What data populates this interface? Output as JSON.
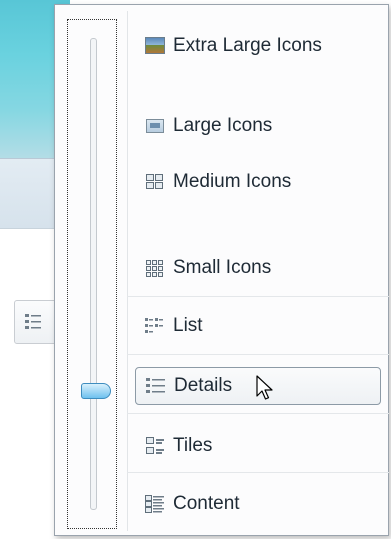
{
  "menu": {
    "items": [
      {
        "label": "Extra Large Icons",
        "icon": "extra-large-icons-icon"
      },
      {
        "label": "Large Icons",
        "icon": "large-icons-icon"
      },
      {
        "label": "Medium Icons",
        "icon": "medium-icons-icon"
      },
      {
        "label": "Small Icons",
        "icon": "small-icons-icon"
      },
      {
        "label": "List",
        "icon": "list-icon"
      },
      {
        "label": "Details",
        "icon": "details-icon",
        "selected": true
      },
      {
        "label": "Tiles",
        "icon": "tiles-icon"
      },
      {
        "label": "Content",
        "icon": "content-icon"
      }
    ],
    "slider": {
      "selected_view": "Details"
    }
  },
  "colors": {
    "thumb": "#9fd6f5",
    "accent": "#58c6d6"
  }
}
